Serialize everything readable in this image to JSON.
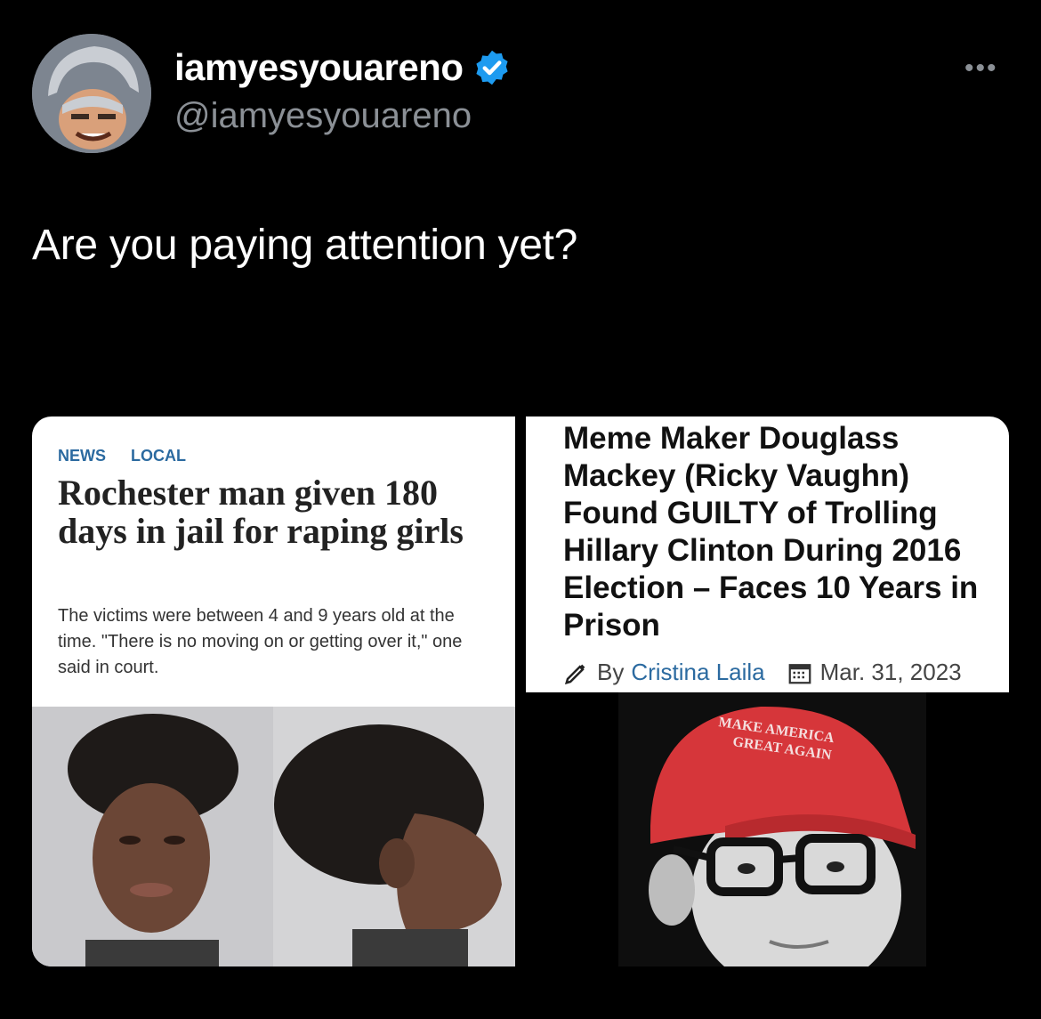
{
  "tweet": {
    "display_name": "iamyesyouareno",
    "handle": "@iamyesyouareno",
    "text": "Are you paying attention yet?",
    "more_label": "•••"
  },
  "left_article": {
    "tags": [
      "NEWS",
      "LOCAL"
    ],
    "headline": "Rochester man given 180 days in jail for raping girls",
    "deck": "The victims were between 4 and 9 years old at the time. \"There is no moving on or getting over it,\" one said in court."
  },
  "right_article": {
    "headline": "Meme Maker Douglass Mackey (Ricky Vaughn) Found GUILTY of Trolling Hillary Clinton During 2016 Election – Faces 10 Years in Prison",
    "byline_prefix": "By",
    "author": "Cristina Laila",
    "date": "Mar. 31, 2023",
    "hat_text_line1": "MAKE AMERICA",
    "hat_text_line2": "GREAT AGAIN"
  },
  "colors": {
    "background": "#000000",
    "verified_badge": "#1d9bf0",
    "link_blue": "#2b6aa0",
    "hat_red": "#d6363a"
  }
}
